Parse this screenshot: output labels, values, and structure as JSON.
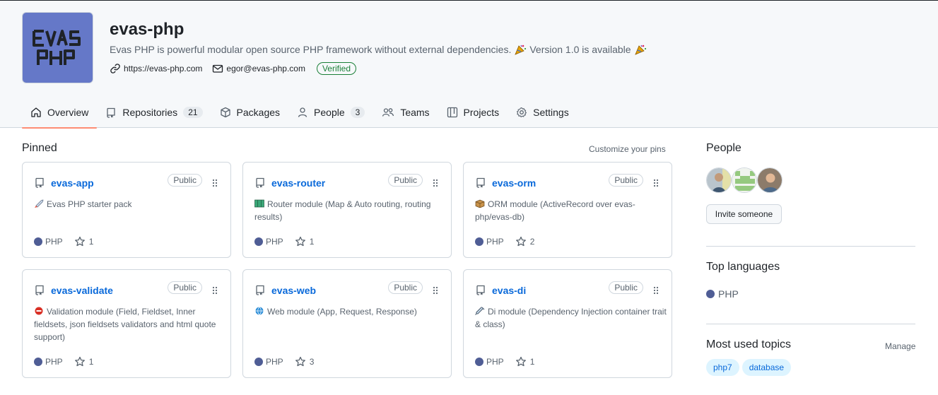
{
  "org": {
    "name": "evas-php",
    "description": "Evas PHP is powerful modular open source PHP framework without external dependencies.",
    "version_note": "Version 1.0 is available",
    "logo_text": "EVAS PHP",
    "website": "https://evas-php.com",
    "email": "egor@evas-php.com",
    "verified_label": "Verified"
  },
  "tabs": [
    {
      "label": "Overview",
      "icon": "home-icon",
      "active": true
    },
    {
      "label": "Repositories",
      "icon": "repo-icon",
      "count": "21"
    },
    {
      "label": "Packages",
      "icon": "package-icon"
    },
    {
      "label": "People",
      "icon": "person-icon",
      "count": "3"
    },
    {
      "label": "Teams",
      "icon": "people-icon"
    },
    {
      "label": "Projects",
      "icon": "table-icon"
    },
    {
      "label": "Settings",
      "icon": "gear-icon"
    }
  ],
  "pinned": {
    "title": "Pinned",
    "customize_label": "Customize your pins",
    "cards": [
      {
        "name": "evas-app",
        "visibility": "Public",
        "emoji": "rocket-emoji",
        "description": "Evas PHP starter pack",
        "language": "PHP",
        "stars": "1"
      },
      {
        "name": "evas-router",
        "visibility": "Public",
        "emoji": "map-emoji",
        "description": "Router module (Map & Auto routing, routing results)",
        "language": "PHP",
        "stars": "1"
      },
      {
        "name": "evas-orm",
        "visibility": "Public",
        "emoji": "package-emoji",
        "description": "ORM module (ActiveRecord over evas-php/evas-db)",
        "language": "PHP",
        "stars": "2"
      },
      {
        "name": "evas-validate",
        "visibility": "Public",
        "emoji": "no-entry-emoji",
        "description": "Validation module (Field, Fieldset, Inner fieldsets, json fieldsets validators and html quote support)",
        "language": "PHP",
        "stars": "1"
      },
      {
        "name": "evas-web",
        "visibility": "Public",
        "emoji": "globe-emoji",
        "description": "Web module (App, Request, Response)",
        "language": "PHP",
        "stars": "3"
      },
      {
        "name": "evas-di",
        "visibility": "Public",
        "emoji": "syringe-emoji",
        "description": "Di module (Dependency Injection container trait & class)",
        "language": "PHP",
        "stars": "1"
      }
    ]
  },
  "sidebar": {
    "people_title": "People",
    "invite_label": "Invite someone",
    "top_languages_title": "Top languages",
    "top_language": "PHP",
    "topics_title": "Most used topics",
    "manage_label": "Manage",
    "topics": [
      "php7",
      "database"
    ]
  },
  "colors": {
    "accent_link": "#0969da",
    "tab_underline": "#fd8c73",
    "php_language": "#4f5d95",
    "verified": "#1a7f37",
    "logo_bg": "#6578c8"
  }
}
